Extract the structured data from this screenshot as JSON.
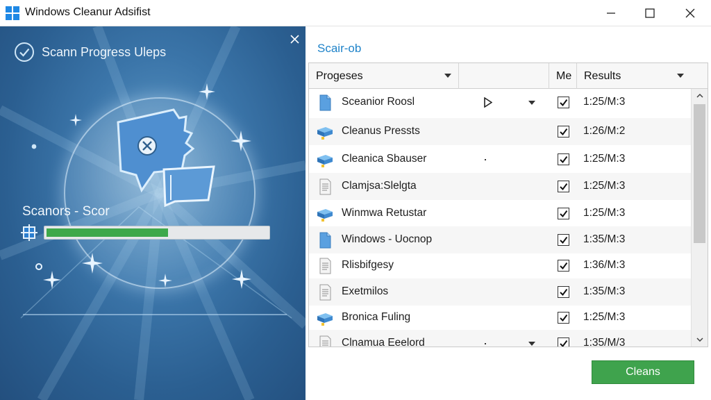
{
  "window": {
    "title": "Windows Cleanur Adsifist",
    "controls": [
      "minimize-icon",
      "maximize-icon",
      "close-icon"
    ]
  },
  "left_panel": {
    "heading": "Scann Progress Uleps",
    "scan_label": "Scanors - Scor",
    "progress": 0.55,
    "colors": {
      "progress_fill": "#3ea84a",
      "panel_bg": "#2b5f91"
    }
  },
  "right_panel": {
    "job_label": "Scair-ob",
    "columns": [
      "Progeses",
      "",
      "Me",
      "Results"
    ],
    "rows": [
      {
        "icon": "document-icon",
        "name": "Sceanior Roosl",
        "extra": "play",
        "checked": true,
        "result": "1:25/M:3"
      },
      {
        "icon": "drive-icon",
        "name": "Cleanus Pressts",
        "extra": "",
        "checked": true,
        "result": "1:26/M:2"
      },
      {
        "icon": "drive-icon",
        "name": "Cleanica Sbauser",
        "extra": "dot",
        "checked": true,
        "result": "1:25/M:3"
      },
      {
        "icon": "text-file-icon",
        "name": "Clamjsa:Slelgta",
        "extra": "",
        "checked": true,
        "result": "1:25/M:3"
      },
      {
        "icon": "drive-icon",
        "name": "Winmwa Retustar",
        "extra": "",
        "checked": true,
        "result": "1:25/M:3"
      },
      {
        "icon": "document-icon",
        "name": "Windows - Uocnop",
        "extra": "",
        "checked": true,
        "result": "1:35/M:3"
      },
      {
        "icon": "text-file-icon",
        "name": "Rlisbifgesy",
        "extra": "",
        "checked": true,
        "result": "1:36/M:3"
      },
      {
        "icon": "text-file-icon",
        "name": "Exetmilos",
        "extra": "",
        "checked": true,
        "result": "1:35/M:3"
      },
      {
        "icon": "drive-icon",
        "name": "Bronica Fuling",
        "extra": "",
        "checked": true,
        "result": "1:25/M:3"
      },
      {
        "icon": "text-file-icon",
        "name": "Clnamua Eeelord",
        "extra": "dot-caret",
        "checked": true,
        "result": "1:35/M/3"
      }
    ],
    "action_button": "Cleans"
  }
}
